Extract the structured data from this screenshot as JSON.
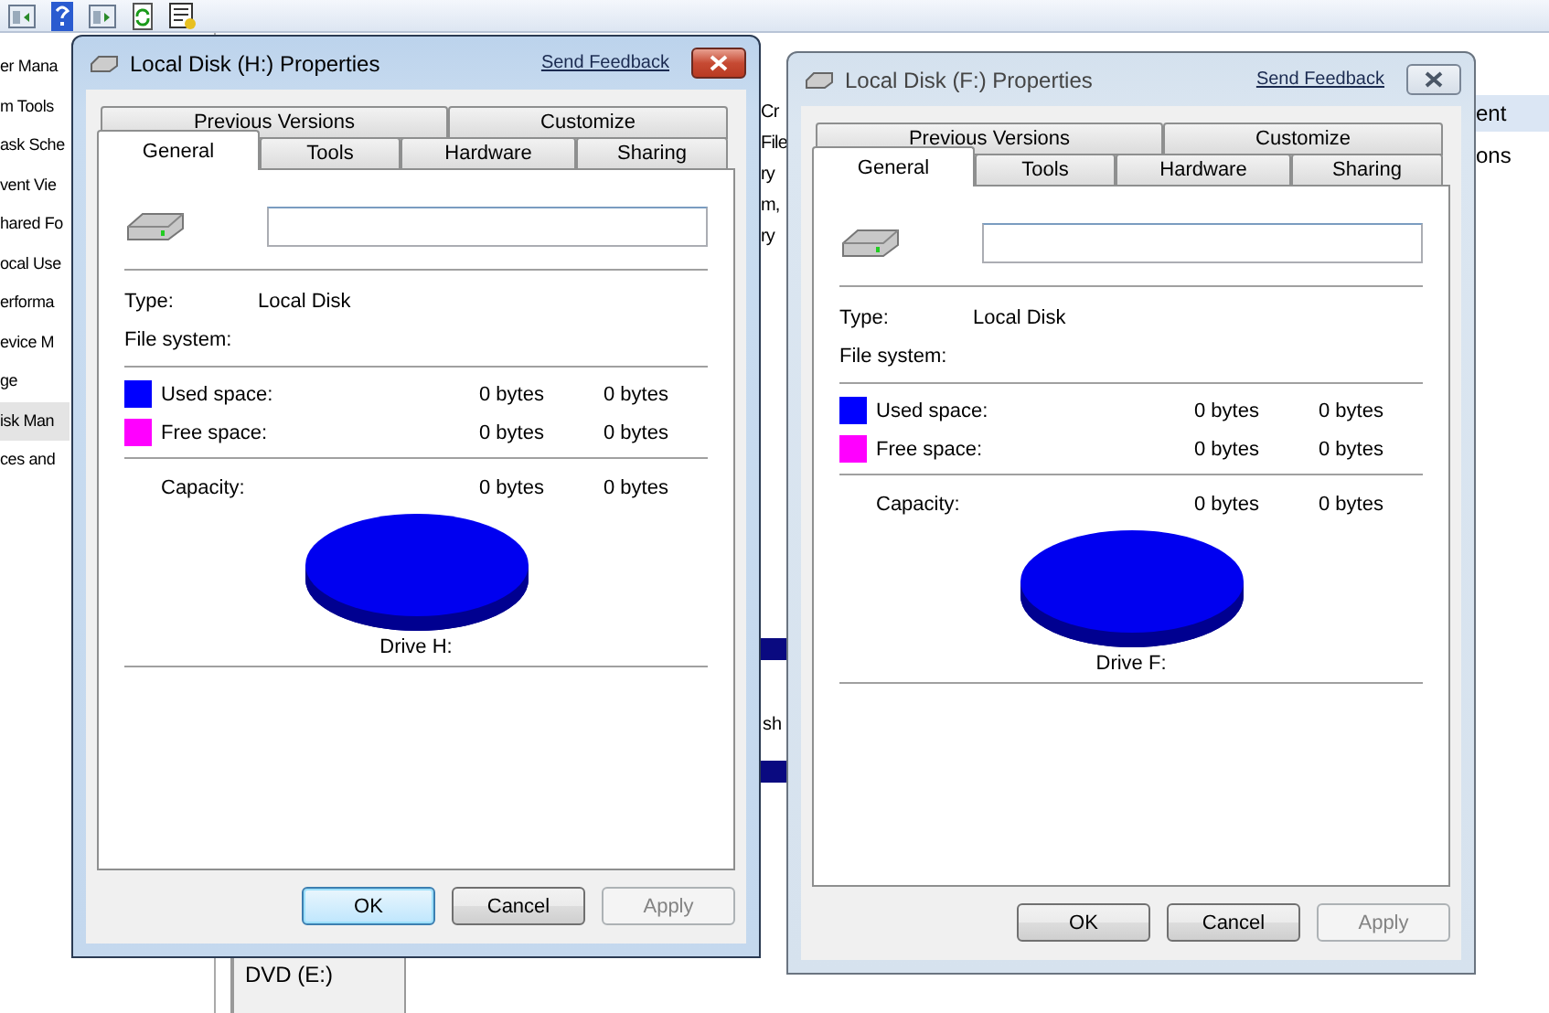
{
  "background": {
    "tree": [
      {
        "label": "er Mana",
        "selected": false
      },
      {
        "label": "m Tools",
        "selected": false
      },
      {
        "label": "ask Sche",
        "selected": false
      },
      {
        "label": "vent Vie",
        "selected": false
      },
      {
        "label": "hared Fo",
        "selected": false
      },
      {
        "label": "ocal Use",
        "selected": false
      },
      {
        "label": "erforma",
        "selected": false
      },
      {
        "label": "evice M",
        "selected": false
      },
      {
        "label": "ge",
        "selected": false
      },
      {
        "label": "isk Man",
        "selected": true
      },
      {
        "label": "ces and",
        "selected": false
      }
    ],
    "middle_fragments": [
      "Cr",
      "File",
      "ry",
      "m,",
      "ry"
    ],
    "lower_fragment": "sh",
    "disk_list": [
      "DVD (E:)"
    ],
    "right_panel": {
      "header": "ent",
      "items": [
        "ons"
      ]
    }
  },
  "dialogs": [
    {
      "title": "Local Disk (H:) Properties",
      "active": true,
      "feedback_link": "Send Feedback",
      "tab_rows": [
        [
          {
            "label": "Previous Versions",
            "selected": false
          },
          {
            "label": "Customize",
            "selected": false
          }
        ],
        [
          {
            "label": "General",
            "selected": true
          },
          {
            "label": "Tools",
            "selected": false
          },
          {
            "label": "Hardware",
            "selected": false
          },
          {
            "label": "Sharing",
            "selected": false
          }
        ]
      ],
      "type_label": "Type:",
      "type_value": "Local Disk",
      "filesystem_label": "File system:",
      "space": [
        {
          "label": "Used space:",
          "color": "#0000ff",
          "bytes": "0 bytes",
          "size": "0 bytes"
        },
        {
          "label": "Free space:",
          "color": "#ff00ff",
          "bytes": "0 bytes",
          "size": "0 bytes"
        }
      ],
      "capacity": {
        "label": "Capacity:",
        "bytes": "0 bytes",
        "size": "0 bytes"
      },
      "drive_label": "Drive H:",
      "buttons": [
        {
          "label": "OK",
          "default": true,
          "disabled": false
        },
        {
          "label": "Cancel",
          "default": false,
          "disabled": false
        },
        {
          "label": "Apply",
          "default": false,
          "disabled": true
        }
      ]
    },
    {
      "title": "Local Disk (F:) Properties",
      "active": false,
      "feedback_link": "Send Feedback",
      "tab_rows": [
        [
          {
            "label": "Previous Versions",
            "selected": false
          },
          {
            "label": "Customize",
            "selected": false
          }
        ],
        [
          {
            "label": "General",
            "selected": true
          },
          {
            "label": "Tools",
            "selected": false
          },
          {
            "label": "Hardware",
            "selected": false
          },
          {
            "label": "Sharing",
            "selected": false
          }
        ]
      ],
      "type_label": "Type:",
      "type_value": "Local Disk",
      "filesystem_label": "File system:",
      "space": [
        {
          "label": "Used space:",
          "color": "#0000ff",
          "bytes": "0 bytes",
          "size": "0 bytes"
        },
        {
          "label": "Free space:",
          "color": "#ff00ff",
          "bytes": "0 bytes",
          "size": "0 bytes"
        }
      ],
      "capacity": {
        "label": "Capacity:",
        "bytes": "0 bytes",
        "size": "0 bytes"
      },
      "drive_label": "Drive F:",
      "buttons": [
        {
          "label": "OK",
          "default": false,
          "disabled": false
        },
        {
          "label": "Cancel",
          "default": false,
          "disabled": false
        },
        {
          "label": "Apply",
          "default": false,
          "disabled": true
        }
      ]
    }
  ]
}
